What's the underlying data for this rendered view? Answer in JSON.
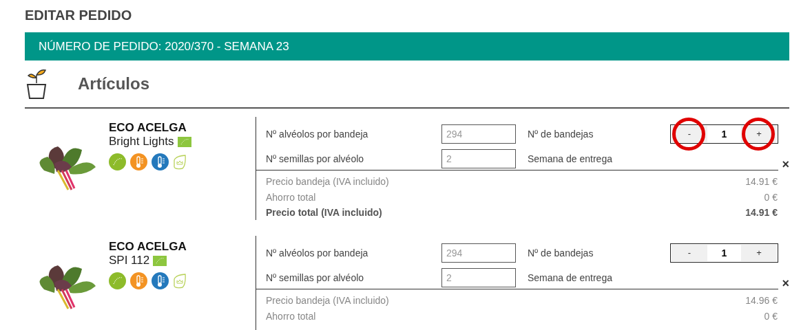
{
  "page_title": "EDITAR PEDIDO",
  "order_banner": "NÚMERO DE PEDIDO: 2020/370 - SEMANA 23",
  "section": {
    "title": "Artículos"
  },
  "items": [
    {
      "name": "ECO ACELGA",
      "variety": "Bright Lights",
      "image": {
        "kind": "picture"
      },
      "fields": [
        {
          "label": "Nº alvéolos por bandeja",
          "value": "294"
        },
        {
          "label": "Nº semillas por alvéolo",
          "value": "2"
        }
      ],
      "trays_label": "Nº de bandejas",
      "minus": "-",
      "quantity": "1",
      "plus": "+",
      "annotated": true,
      "week_label": "Semana de entrega",
      "remove": "×",
      "prices": [
        {
          "kind": "normal",
          "label": "Precio bandeja (IVA incluido)",
          "value": "14.91 €"
        },
        {
          "kind": "normal",
          "label": "Ahorro total",
          "value": "0 €"
        },
        {
          "kind": "total",
          "label": "Precio total (IVA incluido)",
          "value": "14.91 €"
        }
      ]
    },
    {
      "name": "ECO ACELGA",
      "variety": "SPI 112",
      "image": {
        "kind": "picture"
      },
      "fields": [
        {
          "label": "Nº alvéolos por bandeja",
          "value": "294"
        },
        {
          "label": "Nº semillas por alvéolo",
          "value": "2"
        }
      ],
      "trays_label": "Nº de bandejas",
      "minus": "-",
      "quantity": "1",
      "plus": "+",
      "annotated": false,
      "week_label": "Semana de entrega",
      "remove": "×",
      "prices": [
        {
          "kind": "normal",
          "label": "Precio bandeja (IVA incluido)",
          "value": "14.96 €"
        },
        {
          "kind": "normal",
          "label": "Ahorro total",
          "value": "0 €"
        }
      ]
    }
  ]
}
